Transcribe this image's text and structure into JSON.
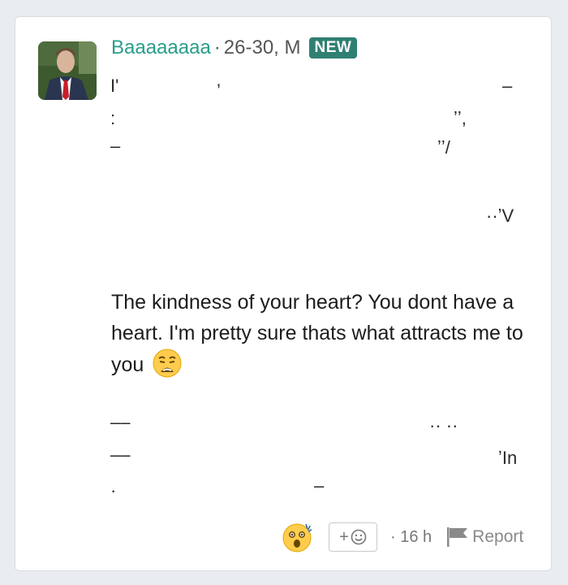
{
  "post": {
    "username": "Baaaaaaaa",
    "separator": "·",
    "age_sex": "26-30, M",
    "badge": "NEW",
    "message": "The kindness of your heart? You dont have a heart. I'm pretty sure thats what attracts me to you",
    "message_emoji": "weary-face",
    "fragments": {
      "f1": "I'",
      "f2": "’",
      "f3": "–",
      "f4": ":",
      "f5": "ʼʼ,",
      "f6": "–",
      "f7": "ʼʼ/",
      "f8": "··ʼV",
      "f9": "––",
      "f10": "·· ··",
      "f11": "––",
      "f12": "ʼIn",
      "f13": "–",
      "f14": "·"
    }
  },
  "footer": {
    "reaction_emoji": "astonished-face",
    "add_reaction_label": "+",
    "timestamp_sep": "·",
    "timestamp": "16 h",
    "report_label": "Report"
  },
  "colors": {
    "username": "#2a9d8a",
    "badge_bg": "#2f7f73",
    "page_bg": "#e9edf1"
  }
}
